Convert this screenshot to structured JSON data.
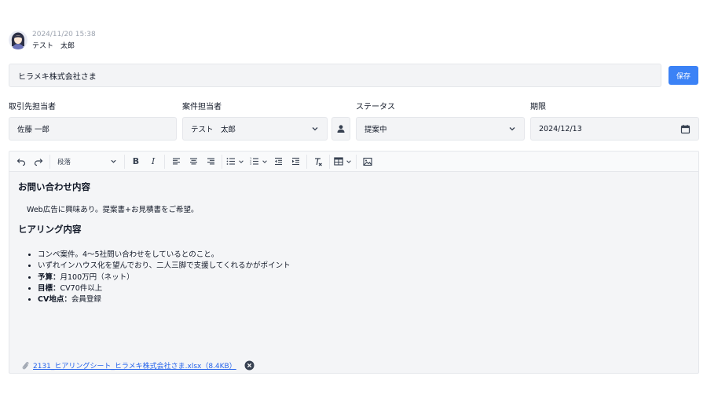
{
  "header": {
    "timestamp": "2024/11/20 15:38",
    "author": "テスト　太郎"
  },
  "title": {
    "value": "ヒラメキ株式会社さま"
  },
  "save_label": "保存",
  "fields": {
    "client_contact": {
      "label": "取引先担当者",
      "value": "佐藤 一郎"
    },
    "deal_owner": {
      "label": "案件担当者",
      "value": "テスト　太郎"
    },
    "status": {
      "label": "ステータス",
      "value": "提案中"
    },
    "deadline": {
      "label": "期限",
      "value": "2024/12/13"
    }
  },
  "toolbar": {
    "paragraph_style": "段落"
  },
  "content": {
    "heading1": "お問い合わせ内容",
    "paragraph1": "Web広告に興味あり。提案書+お見積書をご希望。",
    "heading2": "ヒアリング内容",
    "bullets": [
      {
        "strong": "",
        "text": "コンペ案件。4〜5社問い合わせをしているとのこと。"
      },
      {
        "strong": "",
        "text": "いずれインハウス化を望んでおり、二人三脚で支援してくれるかがポイント"
      },
      {
        "strong": "予算：",
        "text": "月100万円（ネット）"
      },
      {
        "strong": "目標：",
        "text": "CV70件以上"
      },
      {
        "strong": "CV地点：",
        "text": "会員登録"
      }
    ]
  },
  "attachment": {
    "name": "2131_ヒアリングシート_ヒラメキ株式会社さま.xlsx（8.4KB）"
  },
  "colors": {
    "primary": "#3b82f6",
    "link": "#2563eb",
    "field_bg": "#f3f4f6"
  }
}
